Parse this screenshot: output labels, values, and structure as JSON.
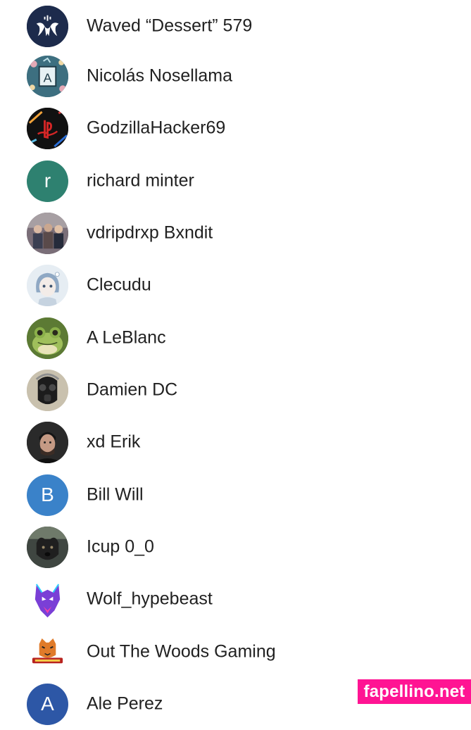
{
  "contacts": [
    {
      "name": "Waved “Dessert” 579",
      "avatar": {
        "kind": "image",
        "icon": "white-sigil-logo",
        "bg": "#1d2b4c"
      }
    },
    {
      "name": "Nicolás Nosellama",
      "avatar": {
        "kind": "image",
        "icon": "framed-letter-a-pattern",
        "bg": "#3d6f80"
      }
    },
    {
      "name": "GodzillaHacker69",
      "avatar": {
        "kind": "image",
        "icon": "playstation-logo",
        "bg": "#111111"
      }
    },
    {
      "name": "richard minter",
      "avatar": {
        "kind": "letter",
        "letter": "r",
        "bg": "#2e8170"
      }
    },
    {
      "name": "vdripdrxp Bxndit",
      "avatar": {
        "kind": "image",
        "icon": "group-photo",
        "bg": "#7a6e78"
      }
    },
    {
      "name": "Clecudu",
      "avatar": {
        "kind": "image",
        "icon": "anime-girl-sketch",
        "bg": "#e6edf3"
      }
    },
    {
      "name": "A LeBlanc",
      "avatar": {
        "kind": "image",
        "icon": "frog-photo",
        "bg": "#5c7a34"
      }
    },
    {
      "name": "Damien DC",
      "avatar": {
        "kind": "image",
        "icon": "gas-mask-photo",
        "bg": "#c9c1ae"
      }
    },
    {
      "name": "xd Erik",
      "avatar": {
        "kind": "image",
        "icon": "man-portrait",
        "bg": "#2a2a2a"
      }
    },
    {
      "name": "Bill Will",
      "avatar": {
        "kind": "letter",
        "letter": "B",
        "bg": "#3a82c9"
      }
    },
    {
      "name": "Icup 0_0",
      "avatar": {
        "kind": "image",
        "icon": "dog-photo",
        "bg": "#3f4641"
      }
    },
    {
      "name": "Wolf_hypebeast",
      "avatar": {
        "kind": "image",
        "icon": "neon-wolf-logo",
        "bg": "#ffffff"
      }
    },
    {
      "name": "Out The Woods Gaming",
      "avatar": {
        "kind": "image",
        "icon": "tiger-gaming-logo",
        "bg": "#ffffff"
      }
    },
    {
      "name": "Ale Perez",
      "avatar": {
        "kind": "letter",
        "letter": "A",
        "bg": "#2d57a6"
      }
    }
  ],
  "watermark": "fapellino.net"
}
